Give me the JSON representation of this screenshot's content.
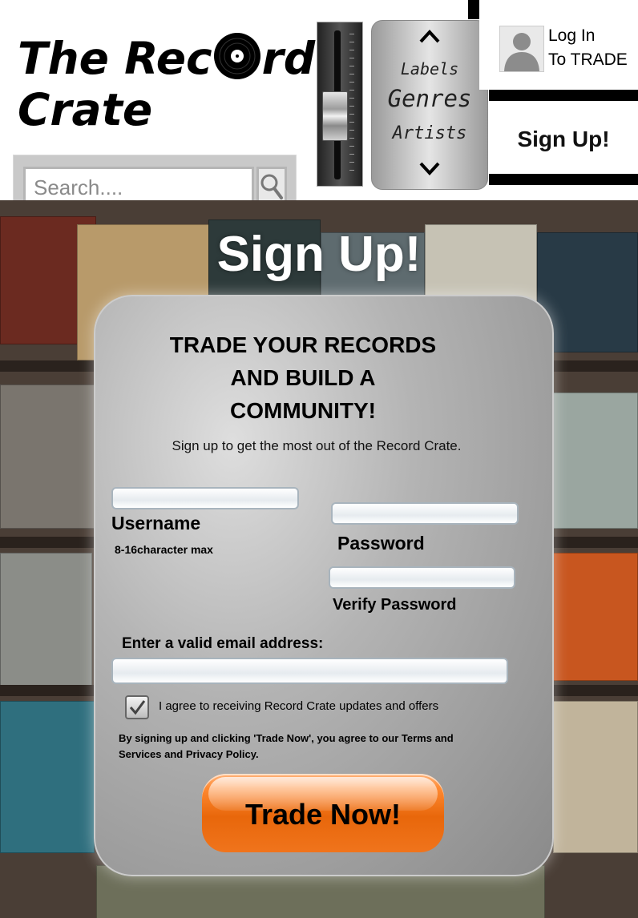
{
  "header": {
    "brand_line1_pre": "The Rec",
    "brand_line1_post": "rd",
    "brand_line2": "Crate",
    "search_placeholder": "Search....",
    "category_nav": {
      "items": [
        "Labels",
        "Genres",
        "Artists"
      ]
    },
    "login_line1": "Log In",
    "login_line2": "To TRADE",
    "signup_link": "Sign Up!"
  },
  "page": {
    "title": "Sign Up!"
  },
  "form": {
    "headline_lines": [
      "TRADE YOUR RECORDS",
      "AND BUILD A",
      "COMMUNITY!"
    ],
    "subline": "Sign up to get the most out of the Record Crate.",
    "username_label": "Username",
    "username_hint": "8-16character max",
    "password_label": "Password",
    "verify_password_label": "Verify Password",
    "email_label": "Enter a valid email address:",
    "consent_label": "I agree to receiving Record Crate updates and offers",
    "consent_checked": true,
    "legal_text": "By signing up and clicking 'Trade Now', you agree to our Terms and Services and Privacy Policy.",
    "submit_label": "Trade Now!"
  },
  "colors": {
    "accent": "#e8670b",
    "panel": "#a8a8a8"
  }
}
